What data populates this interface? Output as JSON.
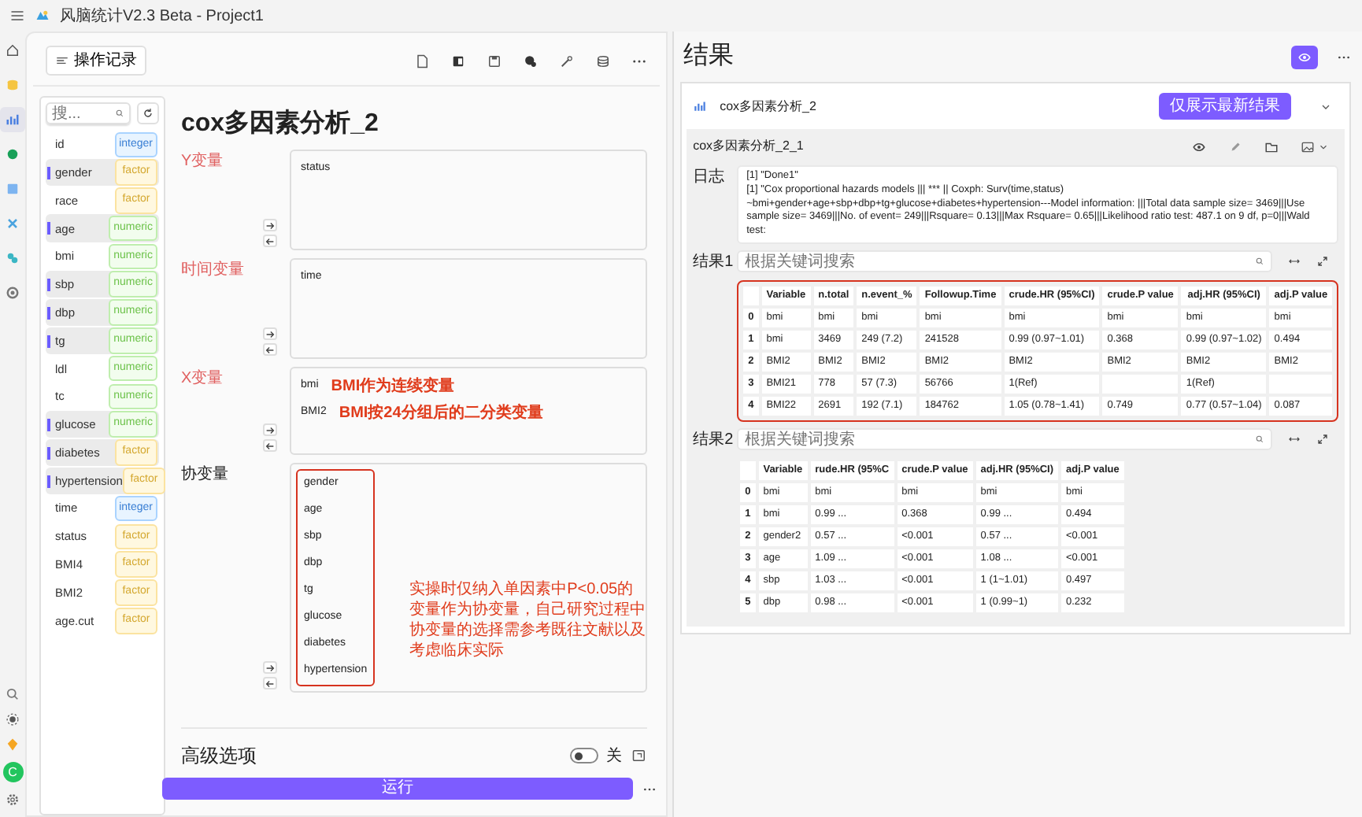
{
  "app": {
    "title": "风脑统计V2.3 Beta - Project1"
  },
  "nav_rail": [
    {
      "selected": false
    },
    {
      "selected": false
    },
    {
      "selected": true
    },
    {
      "selected": false
    },
    {
      "selected": false
    },
    {
      "selected": false
    },
    {
      "selected": false
    },
    {
      "selected": false
    }
  ],
  "avatar": "C",
  "toolbar": {
    "history_button": "操作记录"
  },
  "variables": {
    "search_placeholder": "搜...",
    "items": [
      {
        "name": "id",
        "type": "integer",
        "kind": "integer",
        "selected": false
      },
      {
        "name": "gender",
        "type": "factor",
        "kind": "factor",
        "selected": true
      },
      {
        "name": "race",
        "type": "factor",
        "kind": "factor",
        "selected": false
      },
      {
        "name": "age",
        "type": "numeric",
        "kind": "numeric",
        "selected": true
      },
      {
        "name": "bmi",
        "type": "numeric",
        "kind": "numeric",
        "selected": false
      },
      {
        "name": "sbp",
        "type": "numeric",
        "kind": "numeric",
        "selected": true
      },
      {
        "name": "dbp",
        "type": "numeric",
        "kind": "numeric",
        "selected": true
      },
      {
        "name": "tg",
        "type": "numeric",
        "kind": "numeric",
        "selected": true
      },
      {
        "name": "ldl",
        "type": "numeric",
        "kind": "numeric",
        "selected": false
      },
      {
        "name": "tc",
        "type": "numeric",
        "kind": "numeric",
        "selected": false
      },
      {
        "name": "glucose",
        "type": "numeric",
        "kind": "numeric",
        "selected": true
      },
      {
        "name": "diabetes",
        "type": "factor",
        "kind": "factor",
        "selected": true
      },
      {
        "name": "hypertension",
        "type": "factor",
        "kind": "factor",
        "selected": true
      },
      {
        "name": "time",
        "type": "integer",
        "kind": "integer",
        "selected": false
      },
      {
        "name": "status",
        "type": "factor",
        "kind": "factor",
        "selected": false
      },
      {
        "name": "BMI4",
        "type": "factor",
        "kind": "factor",
        "selected": false
      },
      {
        "name": "BMI2",
        "type": "factor",
        "kind": "factor",
        "selected": false
      },
      {
        "name": "age.cut",
        "type": "factor",
        "kind": "factor",
        "selected": false
      }
    ]
  },
  "analysis": {
    "title": "cox多因素分析_2",
    "sections": [
      {
        "label": "Y变量",
        "required": true,
        "items": [
          {
            "name": "status"
          }
        ]
      },
      {
        "label": "时间变量",
        "required": true,
        "items": [
          {
            "name": "time"
          }
        ]
      },
      {
        "label": "X变量",
        "required": true,
        "items": [
          {
            "name": "bmi",
            "note": "BMI作为连续变量"
          },
          {
            "name": "BMI2",
            "note": "BMI按24分组后的二分类变量"
          }
        ]
      },
      {
        "label": "协变量",
        "required": false,
        "highlighted": true,
        "note": "实操时仅纳入单因素中P<0.05的变量作为协变量，自己研究过程中协变量的选择需参考既往文献以及考虑临床实际",
        "items": [
          {
            "name": "gender"
          },
          {
            "name": "age"
          },
          {
            "name": "sbp"
          },
          {
            "name": "dbp"
          },
          {
            "name": "tg"
          },
          {
            "name": "glucose"
          },
          {
            "name": "diabetes"
          },
          {
            "name": "hypertension"
          }
        ]
      }
    ]
  },
  "advanced": {
    "label": "高级选项",
    "on": false,
    "state_text": "关"
  },
  "run_button": "运行",
  "results": {
    "title": "结果",
    "card": {
      "title": "cox多因素分析_2",
      "latest_button": "仅展示最新结果",
      "expanded": true,
      "result": {
        "title": "cox多因素分析_2_1",
        "log_label": "日志",
        "log_lines": [
          "[1] \"Done1\"",
          "[1] \"Cox proportional hazards models  ||| *** || Coxph: Surv(time,status)",
          "~bmi+gender+age+sbp+dbp+tg+glucose+diabetes+hypertension---Model information: |||Total data sample size= 3469|||Use",
          "sample size= 3469|||No. of event= 249|||Rsquare= 0.13|||Max Rsquare= 0.65|||Likelihood ratio test: 487.1 on 9 df, p=0|||Wald test:"
        ],
        "tables": [
          {
            "label": "结果1",
            "search_placeholder": "根据关键词搜索",
            "highlighted": true,
            "columns": [
              "Variable",
              "n.total",
              "n.event_%",
              "Followup.Time",
              "crude.HR (95%CI)",
              "crude.P value",
              "adj.HR (95%CI)",
              "adj.P value"
            ],
            "rows": [
              {
                "index": "0",
                "cells": [
                  "bmi",
                  "bmi",
                  "bmi",
                  "bmi",
                  "bmi",
                  "bmi",
                  "bmi",
                  "bmi"
                ]
              },
              {
                "index": "1",
                "cells": [
                  "bmi",
                  "3469",
                  "249 (7.2)",
                  "241528",
                  "0.99 (0.97~1.01)",
                  "0.368",
                  "0.99 (0.97~1.02)",
                  "0.494"
                ]
              },
              {
                "index": "2",
                "cells": [
                  "BMI2",
                  "BMI2",
                  "BMI2",
                  "BMI2",
                  "BMI2",
                  "BMI2",
                  "BMI2",
                  "BMI2"
                ]
              },
              {
                "index": "3",
                "cells": [
                  "BMI21",
                  "778",
                  "57 (7.3)",
                  "56766",
                  "1(Ref)",
                  "",
                  "1(Ref)",
                  ""
                ]
              },
              {
                "index": "4",
                "cells": [
                  "BMI22",
                  "2691",
                  "192 (7.1)",
                  "184762",
                  "1.05 (0.78~1.41)",
                  "0.749",
                  "0.77 (0.57~1.04)",
                  "0.087"
                ]
              }
            ]
          },
          {
            "label": "结果2",
            "search_placeholder": "根据关键词搜索",
            "highlighted": false,
            "columns": [
              "Variable",
              "rude.HR (95%C",
              "crude.P value",
              "adj.HR (95%CI)",
              "adj.P value"
            ],
            "rows": [
              {
                "index": "0",
                "cells": [
                  "bmi",
                  "bmi",
                  "bmi",
                  "bmi",
                  "bmi"
                ]
              },
              {
                "index": "1",
                "cells": [
                  "bmi",
                  "0.99 ...",
                  "0.368",
                  "0.99 ...",
                  "0.494"
                ]
              },
              {
                "index": "2",
                "cells": [
                  "gender2",
                  "0.57 ...",
                  "<0.001",
                  "0.57 ...",
                  "<0.001"
                ]
              },
              {
                "index": "3",
                "cells": [
                  "age",
                  "1.09 ...",
                  "<0.001",
                  "1.08 ...",
                  "<0.001"
                ]
              },
              {
                "index": "4",
                "cells": [
                  "sbp",
                  "1.03 ...",
                  "<0.001",
                  "1 (1~1.01)",
                  "0.497"
                ]
              },
              {
                "index": "5",
                "cells": [
                  "dbp",
                  "0.98 ...",
                  "<0.001",
                  "1 (0.99~1)",
                  "0.232"
                ]
              }
            ]
          }
        ]
      }
    }
  }
}
